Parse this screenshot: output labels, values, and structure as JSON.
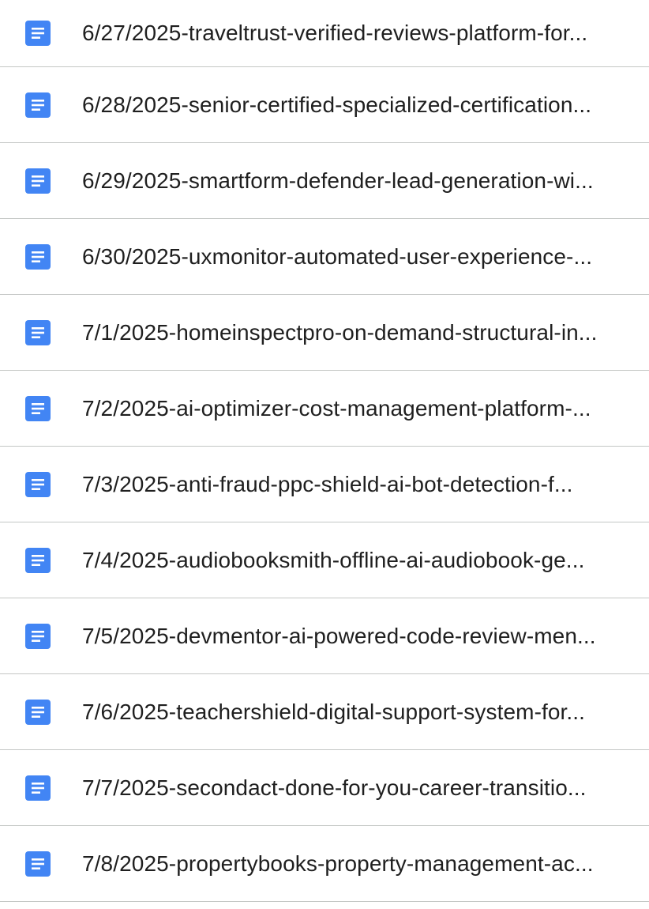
{
  "files": [
    {
      "name": "6/27/2025-traveltrust-verified-reviews-platform-for...",
      "icon": "google-docs-icon"
    },
    {
      "name": "6/28/2025-senior-certified-specialized-certification...",
      "icon": "google-docs-icon"
    },
    {
      "name": "6/29/2025-smartform-defender-lead-generation-wi...",
      "icon": "google-docs-icon"
    },
    {
      "name": "6/30/2025-uxmonitor-automated-user-experience-...",
      "icon": "google-docs-icon"
    },
    {
      "name": "7/1/2025-homeinspectpro-on-demand-structural-in...",
      "icon": "google-docs-icon"
    },
    {
      "name": "7/2/2025-ai-optimizer-cost-management-platform-...",
      "icon": "google-docs-icon"
    },
    {
      "name": "7/3/2025-anti-fraud-ppc-shield-ai-bot-detection-f...",
      "icon": "google-docs-icon"
    },
    {
      "name": "7/4/2025-audiobooksmith-offline-ai-audiobook-ge...",
      "icon": "google-docs-icon"
    },
    {
      "name": "7/5/2025-devmentor-ai-powered-code-review-men...",
      "icon": "google-docs-icon"
    },
    {
      "name": "7/6/2025-teachershield-digital-support-system-for...",
      "icon": "google-docs-icon"
    },
    {
      "name": "7/7/2025-secondact-done-for-you-career-transitio...",
      "icon": "google-docs-icon"
    },
    {
      "name": "7/8/2025-propertybooks-property-management-ac...",
      "icon": "google-docs-icon"
    }
  ],
  "colors": {
    "doc_icon": "#4285f4",
    "divider": "#c4c7c5",
    "text": "#1f1f1f"
  }
}
